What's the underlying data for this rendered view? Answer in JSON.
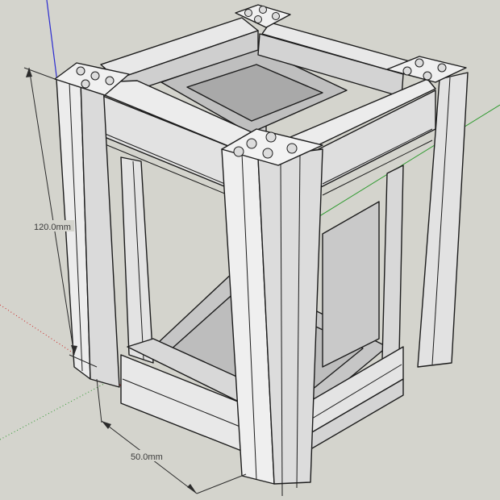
{
  "viewport": {
    "background": "#d4d4cd",
    "axes": {
      "red": "#cc2222",
      "green": "#2e9a2e",
      "blue": "#2a2ad0"
    }
  },
  "model": {
    "profile_face_color": "#ececec",
    "profile_side_color": "#d7d7d7",
    "profile_shadow_color": "#c4c4c4",
    "edge_color": "#1c1c1c"
  },
  "dimensions": {
    "height": {
      "label": "120.0mm"
    },
    "width": {
      "label": "50.0mm"
    }
  }
}
